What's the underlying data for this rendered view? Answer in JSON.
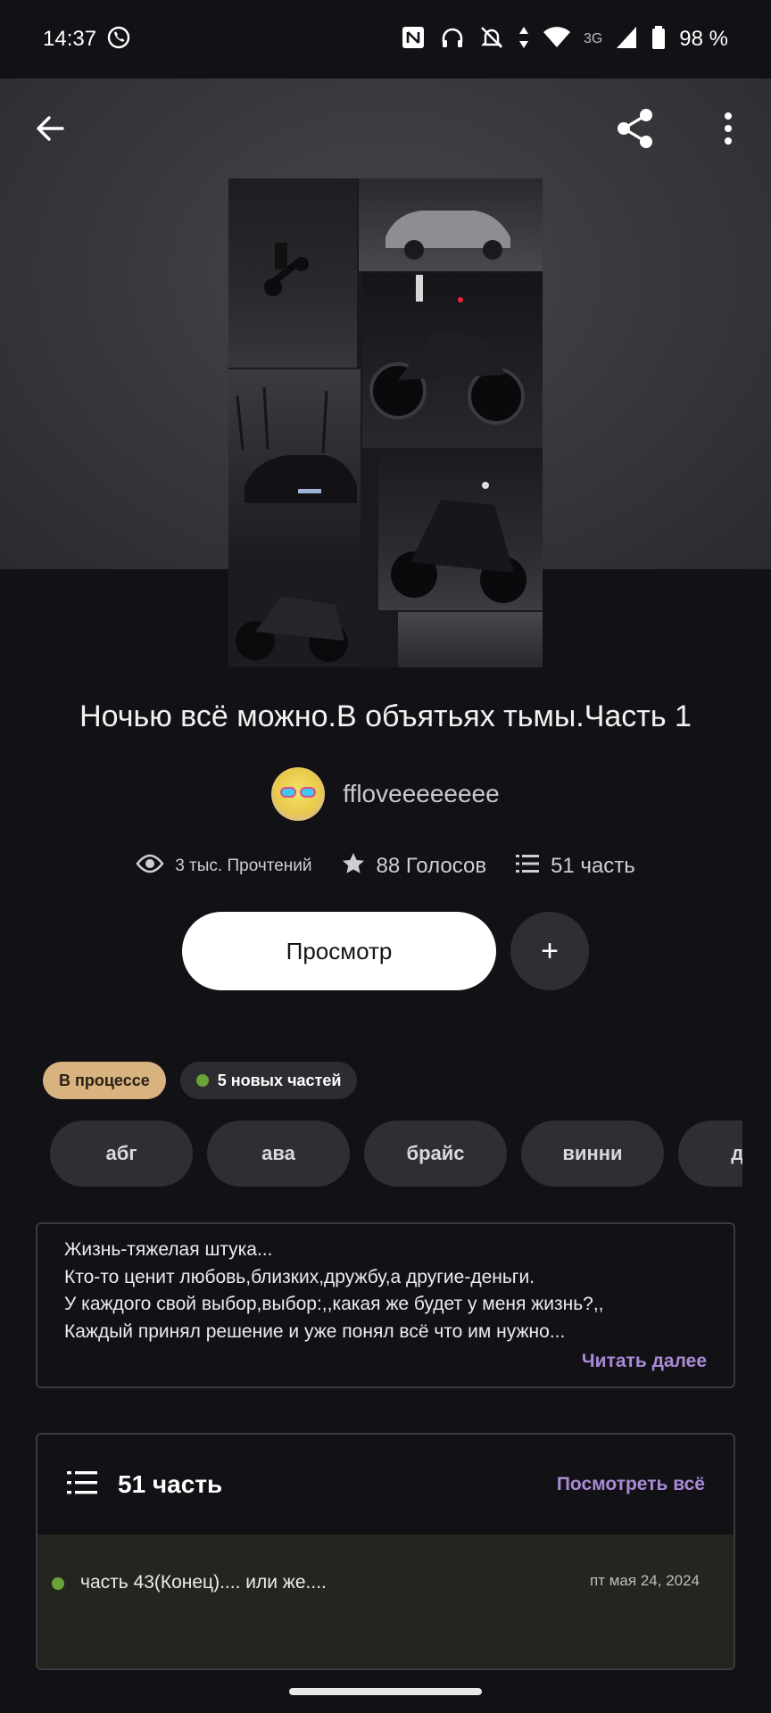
{
  "status_bar": {
    "time": "14:37",
    "network": "3G",
    "battery": "98 %",
    "icons": [
      "viber-icon",
      "nfc-icon",
      "headphones-icon",
      "bell-off-icon",
      "data-arrows-icon",
      "wifi-icon",
      "signal-icon",
      "battery-icon"
    ]
  },
  "app_bar": {
    "icons": [
      "back-arrow-icon",
      "share-icon",
      "more-vertical-icon"
    ]
  },
  "story": {
    "title": "Ночью всё можно.В объятьях тьмы.Часть 1",
    "author": "ffloveeeeeeee",
    "stats": {
      "reads": "3 тыс. Прочтений",
      "votes": "88 Голосов",
      "parts": "51 часть"
    },
    "read_button": "Просмотр",
    "add_button": "+",
    "status_badge": "В процессе",
    "new_parts_badge": "5 новых частей",
    "tags": [
      "абг",
      "ава",
      "брайс",
      "винни",
      "дже"
    ],
    "description": [
      "Жизнь-тяжелая штука...",
      "Кто-то ценит любовь,близких,дружбу,а другие-деньги.",
      "У каждого свой выбор,выбор:,,какая же будет у меня жизнь?,,",
      "Каждый принял решение и уже понял всё что им нужно..."
    ],
    "read_more": "Читать далее"
  },
  "parts_section": {
    "title": "51 часть",
    "view_all": "Посмотреть всё",
    "items": [
      {
        "title": "часть 43(Конец).... или же....",
        "date": "пт мая 24, 2024"
      }
    ]
  },
  "colors": {
    "accent": "#a98ad6",
    "badge_progress": "#d8b27f",
    "new_dot": "#6aa23a",
    "background": "#121115"
  }
}
